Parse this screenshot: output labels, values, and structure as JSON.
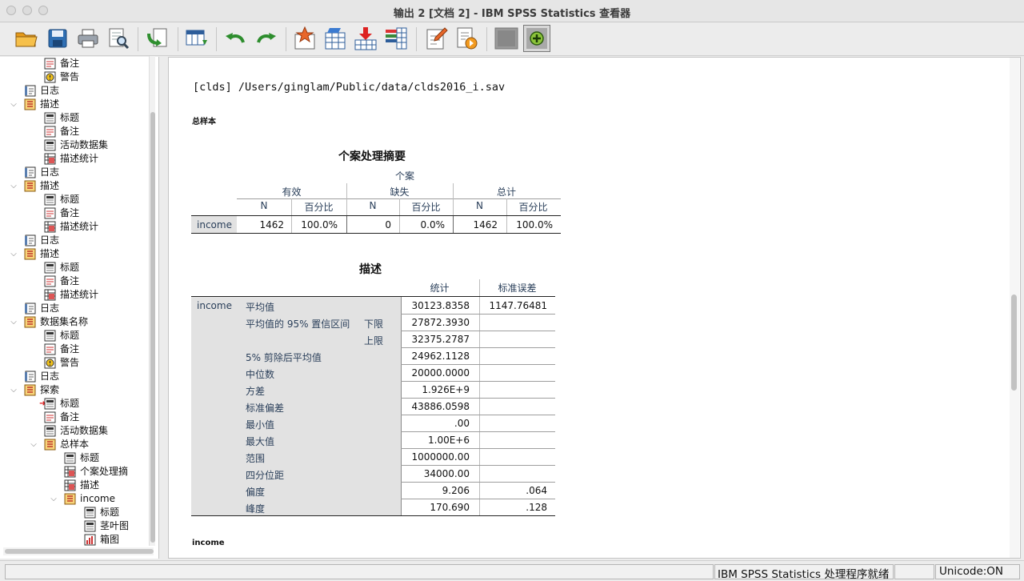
{
  "window": {
    "title": "输出 2 [文档 2] - IBM SPSS Statistics 查看器"
  },
  "toolbar": {
    "buttons": [
      "open-folder-icon",
      "save-icon",
      "print-icon",
      "print-preview-icon",
      "export-icon",
      "goto-data-icon",
      "undo-icon",
      "redo-icon",
      "goto-output-icon",
      "goto-case-icon",
      "insert-variable-icon",
      "variables-icon",
      "designate-window-icon",
      "insert-title-icon",
      "insert-script-icon",
      "hide-icon",
      "show-icon"
    ]
  },
  "tree": [
    {
      "label": "备注",
      "depth": 2,
      "icon": "notes"
    },
    {
      "label": "警告",
      "depth": 2,
      "icon": "warning"
    },
    {
      "label": "日志",
      "depth": 1,
      "icon": "log"
    },
    {
      "label": "描述",
      "depth": 1,
      "icon": "procedure",
      "expanded": true
    },
    {
      "label": "标题",
      "depth": 2,
      "icon": "title"
    },
    {
      "label": "备注",
      "depth": 2,
      "icon": "notes"
    },
    {
      "label": "活动数据集",
      "depth": 2,
      "icon": "title"
    },
    {
      "label": "描述统计",
      "depth": 2,
      "icon": "table"
    },
    {
      "label": "日志",
      "depth": 1,
      "icon": "log"
    },
    {
      "label": "描述",
      "depth": 1,
      "icon": "procedure",
      "expanded": true
    },
    {
      "label": "标题",
      "depth": 2,
      "icon": "title"
    },
    {
      "label": "备注",
      "depth": 2,
      "icon": "notes"
    },
    {
      "label": "描述统计",
      "depth": 2,
      "icon": "table"
    },
    {
      "label": "日志",
      "depth": 1,
      "icon": "log"
    },
    {
      "label": "描述",
      "depth": 1,
      "icon": "procedure",
      "expanded": true
    },
    {
      "label": "标题",
      "depth": 2,
      "icon": "title"
    },
    {
      "label": "备注",
      "depth": 2,
      "icon": "notes"
    },
    {
      "label": "描述统计",
      "depth": 2,
      "icon": "table"
    },
    {
      "label": "日志",
      "depth": 1,
      "icon": "log"
    },
    {
      "label": "数据集名称",
      "depth": 1,
      "icon": "procedure",
      "expanded": true
    },
    {
      "label": "标题",
      "depth": 2,
      "icon": "title"
    },
    {
      "label": "备注",
      "depth": 2,
      "icon": "notes"
    },
    {
      "label": "警告",
      "depth": 2,
      "icon": "warning"
    },
    {
      "label": "日志",
      "depth": 1,
      "icon": "log"
    },
    {
      "label": "探索",
      "depth": 1,
      "icon": "procedure",
      "expanded": true
    },
    {
      "label": "标题",
      "depth": 2,
      "icon": "title",
      "current": true
    },
    {
      "label": "备注",
      "depth": 2,
      "icon": "notes"
    },
    {
      "label": "活动数据集",
      "depth": 2,
      "icon": "title"
    },
    {
      "label": "总样本",
      "depth": 2,
      "icon": "procedure",
      "expanded": true
    },
    {
      "label": "标题",
      "depth": 3,
      "icon": "title"
    },
    {
      "label": "个案处理摘",
      "depth": 3,
      "icon": "table"
    },
    {
      "label": "描述",
      "depth": 3,
      "icon": "table"
    },
    {
      "label": "income",
      "depth": 3,
      "icon": "procedure",
      "expanded": true
    },
    {
      "label": "标题",
      "depth": 4,
      "icon": "title"
    },
    {
      "label": "茎叶图",
      "depth": 4,
      "icon": "title"
    },
    {
      "label": "箱图",
      "depth": 4,
      "icon": "chart"
    }
  ],
  "content": {
    "command": "[clds] /Users/ginglam/Public/data/clds2016_i.sav",
    "section_label": "总样本",
    "footer_label": "income",
    "case_summary": {
      "title": "个案处理摘要",
      "group_header": "个案",
      "col_groups": [
        "有效",
        "缺失",
        "总计"
      ],
      "subheaders": [
        "N",
        "百分比",
        "N",
        "百分比",
        "N",
        "百分比"
      ],
      "row_label": "income",
      "values": [
        "1462",
        "100.0%",
        "0",
        "0.0%",
        "1462",
        "100.0%"
      ]
    },
    "descriptives": {
      "title": "描述",
      "col_headers": [
        "统计",
        "标准误差"
      ],
      "var_label": "income",
      "rows": [
        {
          "label": "平均值",
          "sub": "",
          "stat": "30123.8358",
          "se": "1147.76481"
        },
        {
          "label": "平均值的 95% 置信区间",
          "sub": "下限",
          "stat": "27872.3930",
          "se": ""
        },
        {
          "label": "",
          "sub": "上限",
          "stat": "32375.2787",
          "se": ""
        },
        {
          "label": "5% 剪除后平均值",
          "sub": "",
          "stat": "24962.1128",
          "se": ""
        },
        {
          "label": "中位数",
          "sub": "",
          "stat": "20000.0000",
          "se": ""
        },
        {
          "label": "方差",
          "sub": "",
          "stat": "1.926E+9",
          "se": ""
        },
        {
          "label": "标准偏差",
          "sub": "",
          "stat": "43886.0598",
          "se": ""
        },
        {
          "label": "最小值",
          "sub": "",
          "stat": ".00",
          "se": ""
        },
        {
          "label": "最大值",
          "sub": "",
          "stat": "1.00E+6",
          "se": ""
        },
        {
          "label": "范围",
          "sub": "",
          "stat": "1000000.00",
          "se": ""
        },
        {
          "label": "四分位距",
          "sub": "",
          "stat": "34000.00",
          "se": ""
        },
        {
          "label": "偏度",
          "sub": "",
          "stat": "9.206",
          "se": ".064"
        },
        {
          "label": "峰度",
          "sub": "",
          "stat": "170.690",
          "se": ".128"
        }
      ]
    }
  },
  "status": {
    "processor": "IBM SPSS Statistics 处理程序就绪",
    "unicode": "Unicode:ON"
  }
}
